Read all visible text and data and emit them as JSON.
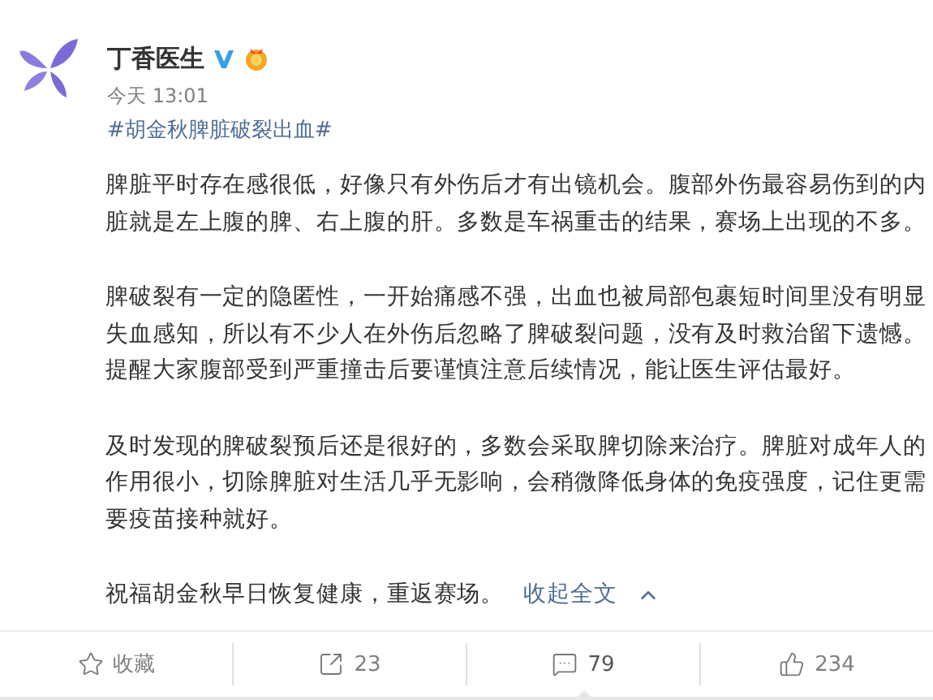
{
  "post": {
    "author": "丁香医生",
    "time": "今天 13:01",
    "hashtag": "#胡金秋脾脏破裂出血#",
    "paragraphs": [
      {
        "lines": [
          "脾脏平时存在感很低，好像只有外伤后才有出镜机会。腹部外伤最容易伤到的内",
          "脏就是左上腹的脾、右上腹的肝。多数是车祸重击的结果，赛场上出现的不多。"
        ]
      },
      {
        "lines": [
          "脾破裂有一定的隐匿性，一开始痛感不强，出血也被局部包裹短时间里没有明显",
          "失血感知，所以有不少人在外伤后忽略了脾破裂问题，没有及时救治留下遗憾。",
          "提醒大家腹部受到严重撞击后要谨慎注意后续情况，能让医生评估最好。"
        ]
      },
      {
        "lines": [
          "及时发现的脾破裂预后还是很好的，多数会采取脾切除来治疗。脾脏对成年人的",
          "作用很小，切除脾脏对生活几乎无影响，会稍微降低身体的免疫强度，记住更需",
          "要疫苗接种就好。"
        ]
      },
      {
        "lines": [
          "祝福胡金秋早日恢复健康，重返赛场。"
        ]
      }
    ],
    "collapse_link": "收起全文"
  },
  "actions": [
    {
      "kind": "favorite",
      "label": "收藏",
      "selected": false
    },
    {
      "kind": "repost",
      "label": "23",
      "selected": false
    },
    {
      "kind": "comment",
      "label": "79",
      "selected": true
    },
    {
      "kind": "like",
      "label": "234",
      "selected": false
    }
  ]
}
